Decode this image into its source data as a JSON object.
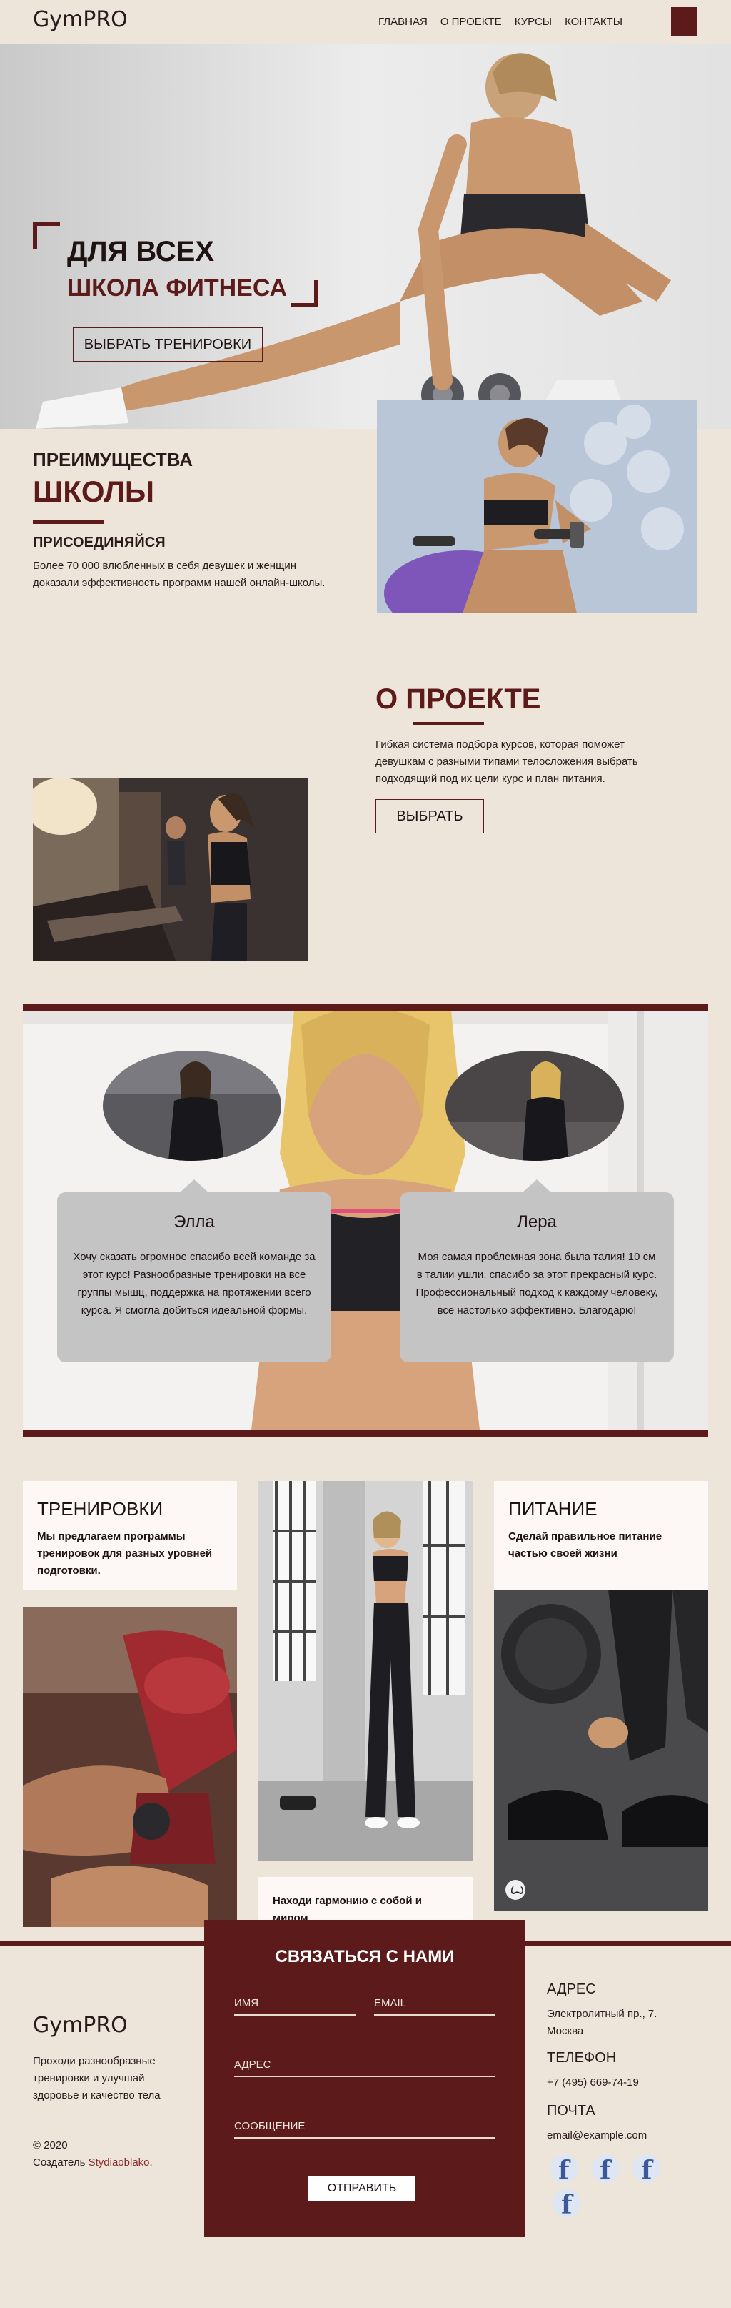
{
  "header": {
    "logo": "GymPRO",
    "nav": [
      "ГЛАВНАЯ",
      "О ПРОЕКТЕ",
      "КУРСЫ",
      "КОНТАКТЫ"
    ]
  },
  "hero": {
    "title": "ДЛЯ ВСЕХ",
    "subtitle": "ШКОЛА ФИТНЕСА",
    "button": "ВЫБРАТЬ ТРЕНИРОВКИ"
  },
  "advantages": {
    "title_line1": "ПРЕИМУЩЕСТВА",
    "title_line2": "ШКОЛЫ",
    "subtitle": "ПРИСОЕДИНЯЙСЯ",
    "text": "Более 70 000 влюбленных в себя девушек и женщин доказали эффективность программ нашей онлайн-школы."
  },
  "about": {
    "title": "О ПРОЕКТЕ",
    "text": "Гибкая система подбора курсов, которая поможет девушкам с разными типами телосложения выбрать подходящий под их цели курс и план питания.",
    "button": "ВЫБРАТЬ"
  },
  "testimonials": [
    {
      "name": "Элла",
      "text": "Хочу сказать огромное спасибо всей команде за этот курс! Разнообразные тренировки на все группы мышц, поддержка на протяжении всего курса. Я смогла добиться идеальной формы."
    },
    {
      "name": "Лера",
      "text": "Моя самая проблемная зона была талия! 10 см в талии ушли, спасибо за этот прекрасный курс. Профессиональный подход к каждому человеку, все настолько эффективно. Благодарю!"
    }
  ],
  "programs": {
    "workouts": {
      "title": "ТРЕНИРОВКИ",
      "text": "Мы предлагаем программы тренировок для разных уровней подготовки."
    },
    "nutrition": {
      "title": "ПИТАНИЕ",
      "text": "Сделай правильное питание частью своей жизни"
    },
    "harmony": {
      "text": "Находи гармонию с собой и миром"
    }
  },
  "footer": {
    "logo": "GymPRO",
    "description": "Проходи разнообразные тренировки и улучшай здоровье и качество тела",
    "copyright": "© 2020",
    "creator_label": "Создатель",
    "creator_link": "Stydiaoblako",
    "creator_suffix": "."
  },
  "contact_form": {
    "title": "СВЯЗАТЬСЯ С НАМИ",
    "name_placeholder": "ИМЯ",
    "email_placeholder": "EMAIL",
    "address_placeholder": "АДРЕС",
    "message_placeholder": "СООБЩЕНИЕ",
    "submit": "ОТПРАВИТЬ"
  },
  "contact_info": {
    "address_label": "АДРЕС",
    "address": "Электролитный пр., 7. Москва",
    "phone_label": "ТЕЛЕФОН",
    "phone": "+7 (495) 669-74-19",
    "mail_label": "ПОЧТА",
    "mail": "email@example.com"
  },
  "social": [
    "facebook-icon",
    "facebook-icon",
    "facebook-icon",
    "facebook-icon"
  ],
  "colors": {
    "accent": "#5c1a1a",
    "background": "#ede4da",
    "card": "#c4c4c4",
    "link": "#8a2a2a"
  }
}
